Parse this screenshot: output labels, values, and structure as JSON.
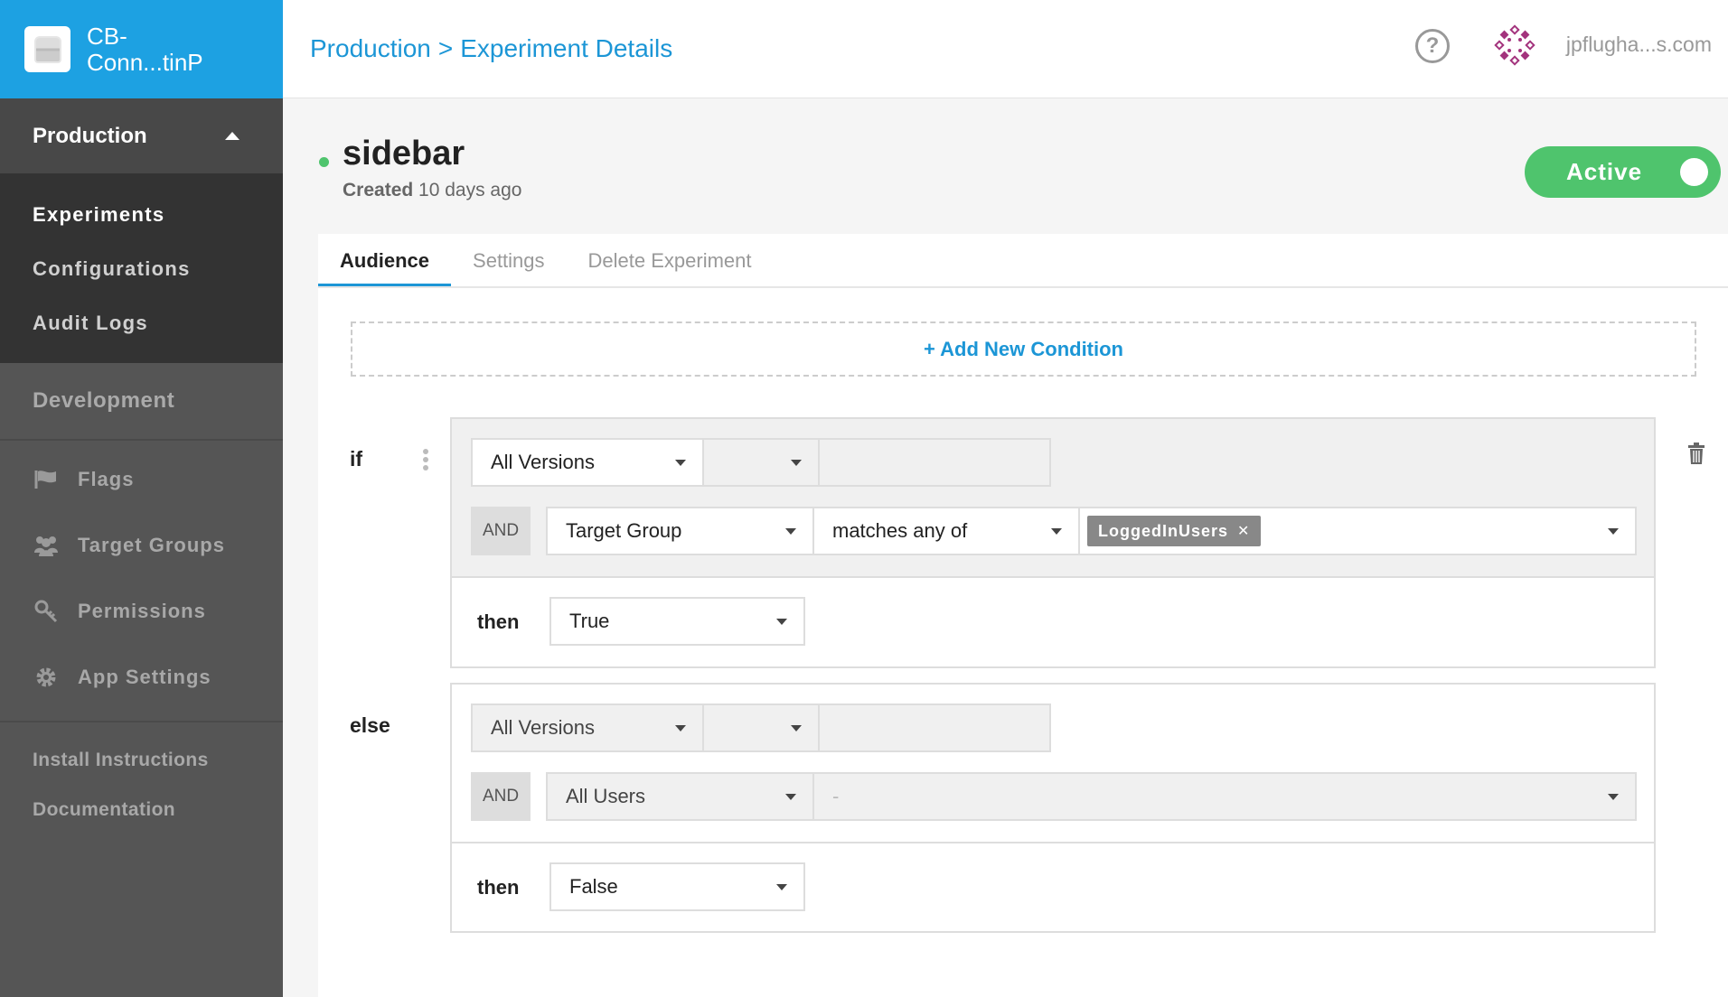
{
  "app": {
    "name": "CB-\nConn...tinP"
  },
  "sidebar": {
    "env_current": "Production",
    "env_nav": [
      "Experiments",
      "Configurations",
      "Audit Logs"
    ],
    "env_other": "Development",
    "menu": [
      {
        "label": "Flags",
        "icon": "flag-icon"
      },
      {
        "label": "Target Groups",
        "icon": "users-icon"
      },
      {
        "label": "Permissions",
        "icon": "key-icon"
      },
      {
        "label": "App Settings",
        "icon": "gear-icon"
      }
    ],
    "links": [
      "Install Instructions",
      "Documentation"
    ]
  },
  "header": {
    "breadcrumb": [
      "Production",
      ">",
      "Experiment Details"
    ],
    "help_icon": "question-circle-icon",
    "user_email": "jpflugha...s.com"
  },
  "experiment": {
    "name": "sidebar",
    "created_label": "Created",
    "created_value": "10 days ago",
    "status_label": "Active",
    "status_color": "#4fc46d"
  },
  "tabs": [
    "Audience",
    "Settings",
    "Delete Experiment"
  ],
  "audience": {
    "add_condition": "+ Add New Condition",
    "if_label": "if",
    "else_label": "else",
    "if_rule": {
      "version": "All Versions",
      "version_op": "",
      "version_value": "",
      "and": "AND",
      "attribute": "Target Group",
      "operator": "matches any of",
      "chips": [
        "LoggedInUsers"
      ],
      "then_label": "then",
      "then_value": "True"
    },
    "else_rule": {
      "version": "All Versions",
      "version_op": "",
      "version_value": "",
      "and": "AND",
      "attribute": "All Users",
      "operator_placeholder": "-",
      "then_label": "then",
      "then_value": "False"
    }
  },
  "colors": {
    "brand": "#1da1e2",
    "link": "#1c96d6",
    "active": "#4fc46d"
  }
}
